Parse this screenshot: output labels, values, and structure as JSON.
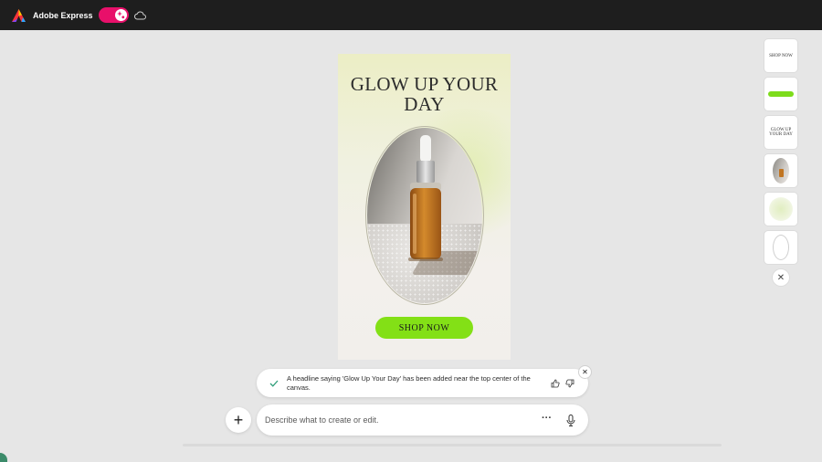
{
  "app": {
    "name": "Adobe Express"
  },
  "icons": {
    "logo": "adobe-express-logo",
    "toggle": "generative-ai-toggle",
    "cloud": "cloud-icon",
    "check": "checkmark-icon",
    "thumbs_up": "thumbs-up-icon",
    "thumbs_down": "thumbs-down-icon",
    "close": "close-icon",
    "add": "plus-icon",
    "more": "more-icon",
    "mic": "microphone-icon"
  },
  "colors": {
    "topbar": "#1e1e1e",
    "toggle": "#e8106a",
    "cta": "#83e016",
    "workspace": "#e6e6e6"
  },
  "canvas": {
    "headline": "GLOW UP YOUR DAY",
    "cta_label": "SHOP NOW"
  },
  "layers": {
    "items": [
      {
        "type": "text",
        "label": "SHOP NOW"
      },
      {
        "type": "shape",
        "label": ""
      },
      {
        "type": "text",
        "label": "GLOW UP YOUR DAY"
      },
      {
        "type": "image",
        "label": ""
      },
      {
        "type": "shape",
        "label": ""
      },
      {
        "type": "shape",
        "label": ""
      }
    ],
    "close_glyph": "✕"
  },
  "notification": {
    "message": "A headline saying 'Glow Up Your Day' has been added near the top center of the canvas.",
    "close_glyph": "✕"
  },
  "prompt": {
    "placeholder": "Describe what to create or edit.",
    "value": "",
    "add_glyph": "+",
    "more_glyph": "···"
  }
}
